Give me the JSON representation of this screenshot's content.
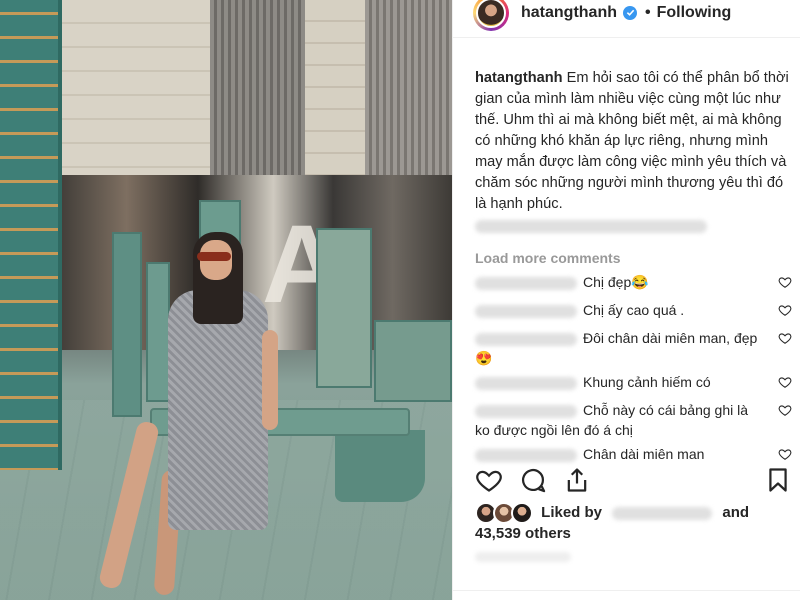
{
  "post": {
    "username": "hatangthanh",
    "follow_status": "Following",
    "dot": "•",
    "caption_user": "hatangthanh",
    "caption_text": "Em hỏi sao tôi có thể phân bổ thời gian của mình làm nhiều việc cùng một lúc như thế. Uhm thì ai mà không biết mệt, ai mà không có những khó khăn áp lực riêng, nhưng mình may mắn được làm công việc mình yêu thích và chăm sóc những người mình thương yêu thì đó là hạnh phúc.",
    "load_more": "Load more comments"
  },
  "comments": [
    {
      "text": "Chị đẹp😂"
    },
    {
      "text": "Chị ấy cao quá ."
    },
    {
      "text": "Đôi chân dài miên man, đẹp 😍"
    },
    {
      "text": "Khung cảnh hiếm có"
    },
    {
      "text": "Chỗ này có cái bảng ghi là ko được ngồi lên đó á chị"
    },
    {
      "text": "Chân dài miên man"
    }
  ],
  "likes": {
    "prefix": "Liked by",
    "and": "and",
    "count_text": "43,539 others"
  },
  "icons": {
    "verified": "verified-badge-icon",
    "heart": "heart-icon",
    "comment": "comment-icon",
    "share": "share-icon",
    "bookmark": "bookmark-icon"
  },
  "colors": {
    "verified": "#3897f0",
    "muted": "#999999",
    "text": "#262626"
  }
}
